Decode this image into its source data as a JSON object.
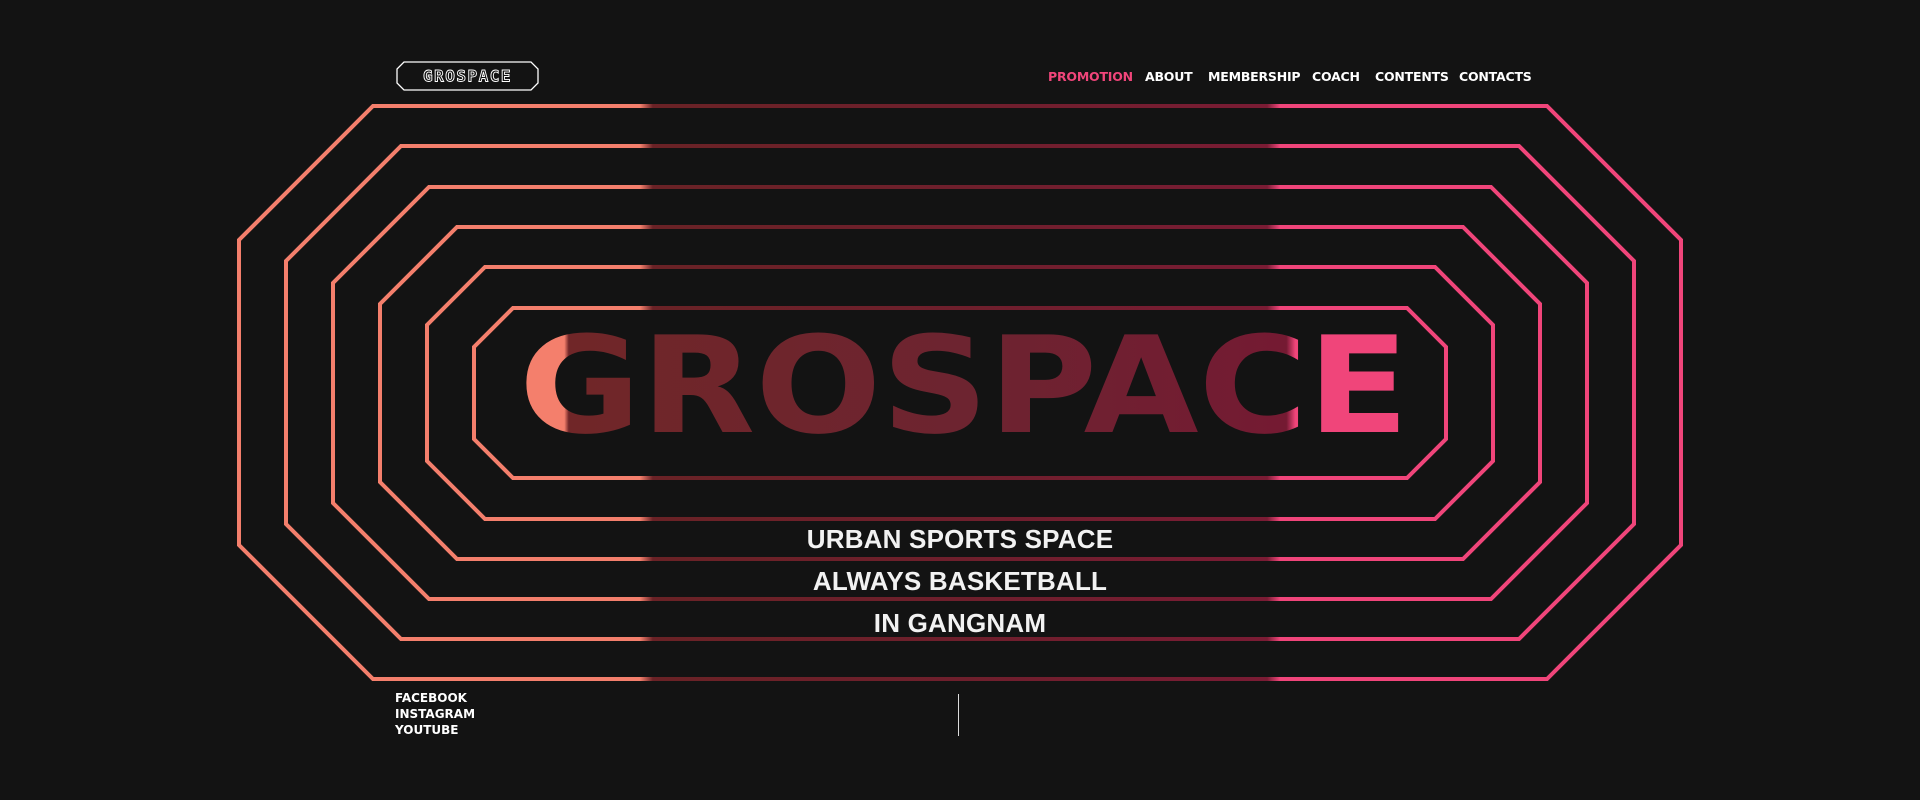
{
  "brand": {
    "logo_text": "GROSPACE",
    "hero_text": "GROSPACE"
  },
  "nav": {
    "items": [
      {
        "label": "PROMOTION",
        "active": true
      },
      {
        "label": "ABOUT",
        "active": false
      },
      {
        "label": "MEMBERSHIP",
        "active": false
      },
      {
        "label": "COACH",
        "active": false
      },
      {
        "label": "CONTENTS",
        "active": false
      },
      {
        "label": "CONTACTS",
        "active": false
      }
    ]
  },
  "hero": {
    "tagline": [
      "URBAN SPORTS SPACE",
      "ALWAYS BASKETBALL",
      "IN GANGNAM"
    ]
  },
  "social": {
    "links": [
      "FACEBOOK",
      "INSTAGRAM",
      "YOUTUBE"
    ]
  },
  "colors": {
    "background": "#131313",
    "accent_pink": "#f0457a",
    "accent_salmon": "#f47f6c",
    "dark_red": "#7a2030"
  }
}
